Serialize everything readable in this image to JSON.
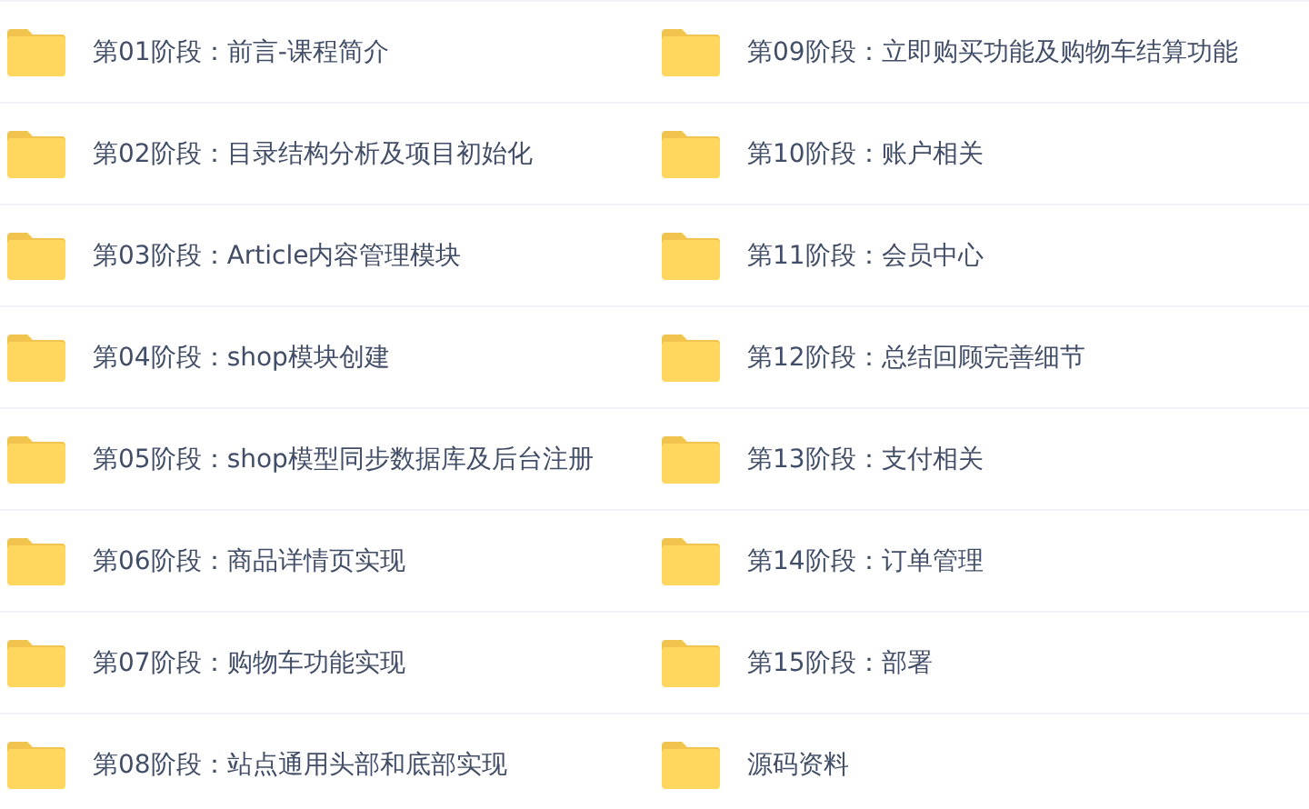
{
  "folders": [
    {
      "name": "第01阶段：前言-课程简介"
    },
    {
      "name": "第02阶段：目录结构分析及项目初始化"
    },
    {
      "name": "第03阶段：Article内容管理模块"
    },
    {
      "name": "第04阶段：shop模块创建"
    },
    {
      "name": "第05阶段：shop模型同步数据库及后台注册"
    },
    {
      "name": "第06阶段：商品详情页实现"
    },
    {
      "name": "第07阶段：购物车功能实现"
    },
    {
      "name": "第08阶段：站点通用头部和底部实现"
    },
    {
      "name": "第09阶段：立即购买功能及购物车结算功能"
    },
    {
      "name": "第10阶段：账户相关"
    },
    {
      "name": "第11阶段：会员中心"
    },
    {
      "name": "第12阶段：总结回顾完善细节"
    },
    {
      "name": "第13阶段：支付相关"
    },
    {
      "name": "第14阶段：订单管理"
    },
    {
      "name": "第15阶段：部署"
    },
    {
      "name": "源码资料"
    }
  ]
}
